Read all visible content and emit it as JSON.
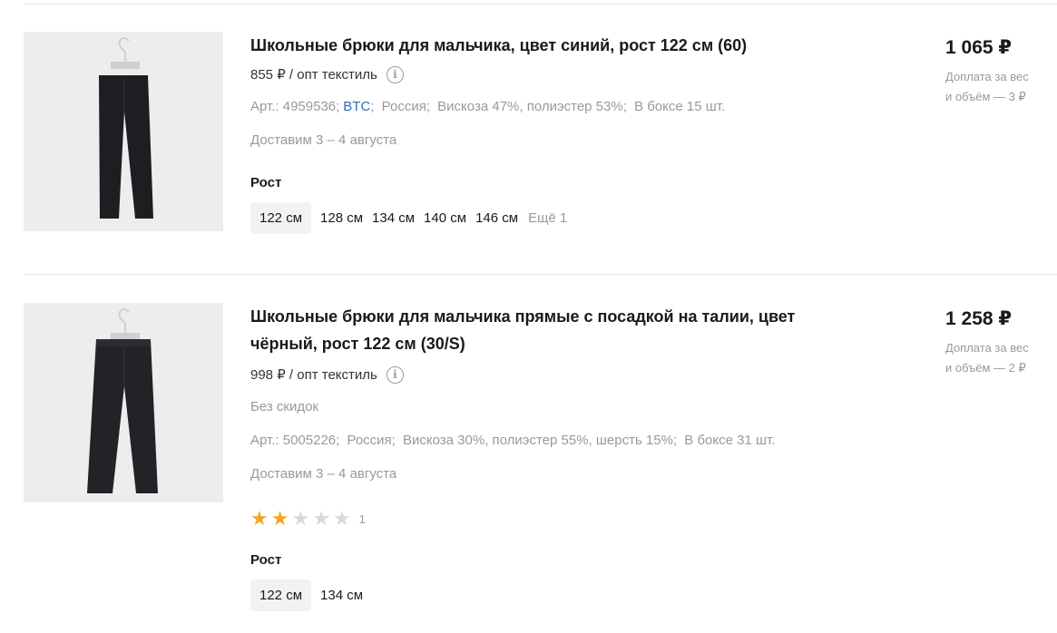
{
  "products": [
    {
      "title": "Школьные брюки для мальчика, цвет синий, рост 122 см (60)",
      "wholesale_price": "855 ₽ / опт текстиль",
      "info_icon": "i",
      "article": "Арт.: 4959536;",
      "brand": "BTC",
      "country": "Россия;",
      "composition": "Вискоза 47%, полиэстер 53%;",
      "box": "В боксе 15 шт.",
      "delivery": "Доставим 3 – 4 августа",
      "size_label": "Рост",
      "sizes": [
        "122 см",
        "128 см",
        "134 см",
        "140 см",
        "146 см"
      ],
      "more_sizes": "Ещё 1",
      "price": "1 065 ₽",
      "surcharge_line1": "Доплата за вес",
      "surcharge_line2": "и объём — 3 ₽"
    },
    {
      "title_line1": "Школьные брюки для мальчика прямые с посадкой на талии, цвет",
      "title_line2": "чёрный, рост 122 см (30/S)",
      "wholesale_price": "998 ₽ / опт текстиль",
      "info_icon": "i",
      "discount": "Без скидок",
      "article": "Арт.: 5005226;",
      "country": "Россия;",
      "composition": "Вискоза 30%, полиэстер 55%, шерсть 15%;",
      "box": "В боксе 31 шт.",
      "delivery": "Доставим 3 – 4 августа",
      "rating": 2,
      "rating_max": 5,
      "reviews_count": "1",
      "size_label": "Рост",
      "sizes": [
        "122 см",
        "134 см"
      ],
      "price": "1 258 ₽",
      "surcharge_line1": "Доплата за вес",
      "surcharge_line2": "и объём — 2 ₽"
    }
  ],
  "colors": {
    "link": "#2e6fbf",
    "star_on": "#f5a623",
    "star_off": "#d9d9d9",
    "muted_text": "#999999"
  },
  "icons": {
    "info": "info-circle-icon",
    "star": "star-icon"
  }
}
